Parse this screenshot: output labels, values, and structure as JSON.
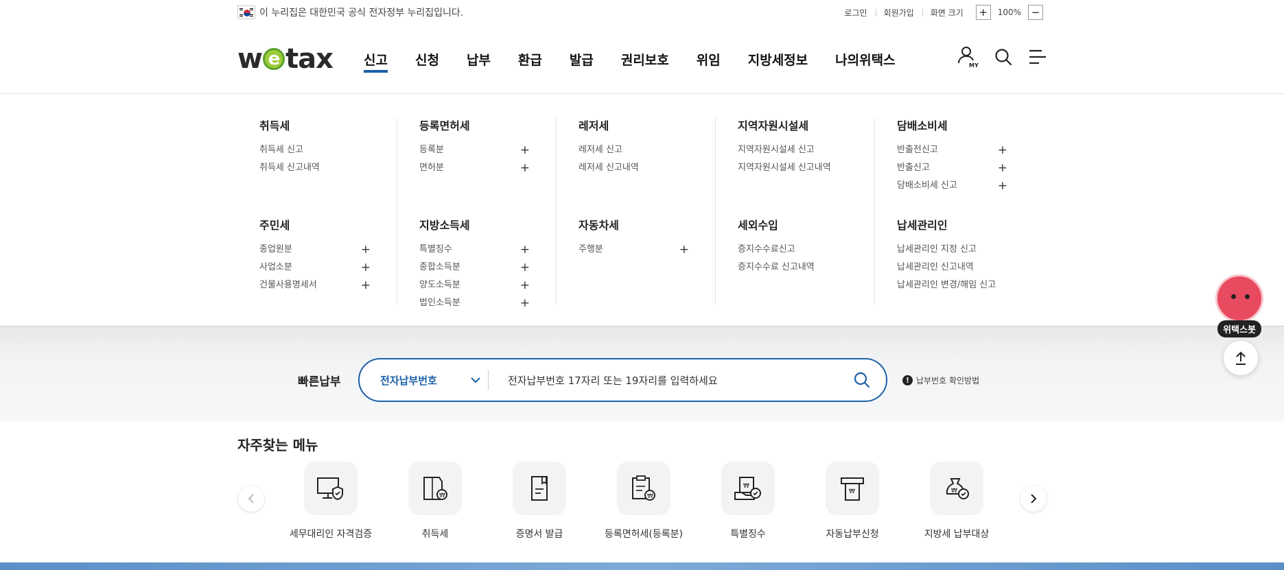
{
  "topbar": {
    "gov_notice": "이 누리집은 대한민국 공식 전자정부 누리집입니다.",
    "login": "로그인",
    "signup": "회원가입",
    "screen_size": "화면 크기",
    "zoom_in": "+",
    "zoom_level": "100%",
    "zoom_out": "−"
  },
  "logo": {
    "pre": "w",
    "mid": "e",
    "post": "tax"
  },
  "nav": [
    "신고",
    "신청",
    "납부",
    "환급",
    "발급",
    "권리보호",
    "위임",
    "지방세정보",
    "나의위택스"
  ],
  "icons": {
    "my_label": "MY"
  },
  "mega": {
    "col1": {
      "g1": {
        "title": "취득세",
        "items": [
          "취득세 신고",
          "취득세 신고내역"
        ]
      },
      "g2": {
        "title": "주민세",
        "items": [
          "종업원분",
          "사업소분",
          "건물사용명세서"
        ]
      }
    },
    "col2": {
      "g1": {
        "title": "등록면허세",
        "items": [
          "등록분",
          "면허분"
        ]
      },
      "g2": {
        "title": "지방소득세",
        "items": [
          "특별징수",
          "종합소득분",
          "양도소득분",
          "법인소득분"
        ]
      }
    },
    "col3": {
      "g1": {
        "title": "레저세",
        "items": [
          "레저세 신고",
          "레저세 신고내역"
        ]
      },
      "g2": {
        "title": "자동차세",
        "items": [
          "주행분"
        ]
      }
    },
    "col4": {
      "g1": {
        "title": "지역자원시설세",
        "items": [
          "지역자원시설세 신고",
          "지역자원시설세 신고내역"
        ]
      },
      "g2": {
        "title": "세외수입",
        "items": [
          "증지수수료신고",
          "증지수수료 신고내역"
        ]
      }
    },
    "col5": {
      "g1": {
        "title": "담배소비세",
        "items": [
          "반출전신고",
          "반출신고",
          "담배소비세 신고"
        ]
      },
      "g2": {
        "title": "납세관리인",
        "items": [
          "납세관리인 지정 신고",
          "납세관리인 신고내역",
          "납세관리인 변경/해임 신고"
        ]
      }
    },
    "plus": "+"
  },
  "quick": {
    "title": "빠른납부",
    "select": "전자납부번호",
    "placeholder": "전자납부번호 17자리 또는 19자리를 입력하세요",
    "help": "납부번호 확인방법",
    "help_mark": "!"
  },
  "freq": {
    "title": "자주찾는 메뉴",
    "items": [
      "세무대리인 자격검증",
      "취득세",
      "증명서 발급",
      "등록면허세(등록분)",
      "특별징수",
      "자동납부신청",
      "지방세 납부대상"
    ]
  },
  "bot": {
    "label": "위택스봇"
  }
}
